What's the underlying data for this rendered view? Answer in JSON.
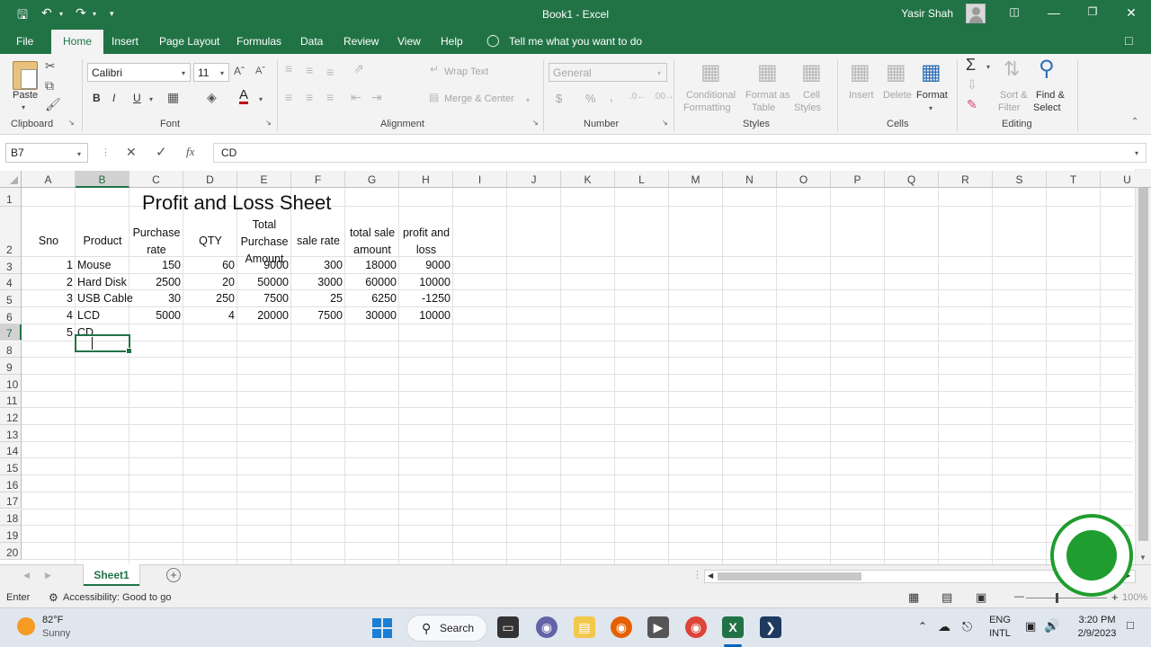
{
  "window": {
    "title": "Book1  -  Excel",
    "user": "Yasir Shah"
  },
  "menu_tabs": [
    "File",
    "Home",
    "Insert",
    "Page Layout",
    "Formulas",
    "Data",
    "Review",
    "View",
    "Help"
  ],
  "tell_me": "Tell me what you want to do",
  "ribbon": {
    "clipboard": {
      "paste": "Paste",
      "label": "Clipboard"
    },
    "font": {
      "family": "Calibri",
      "size": "11",
      "label": "Font",
      "bold": "B",
      "italic": "I",
      "underline": "U"
    },
    "alignment": {
      "wrap_text": "Wrap Text",
      "merge_center": "Merge & Center",
      "label": "Alignment"
    },
    "number": {
      "format": "General",
      "currency": "$",
      "percent": "%",
      "comma": ",",
      "label": "Number"
    },
    "styles": {
      "conditional_1": "Conditional",
      "conditional_2": "Formatting",
      "format_as_1": "Format as",
      "format_as_2": "Table",
      "cell_styles_1": "Cell",
      "cell_styles_2": "Styles",
      "label": "Styles"
    },
    "cells": {
      "insert": "Insert",
      "delete": "Delete",
      "format": "Format",
      "label": "Cells"
    },
    "editing": {
      "sort_1": "Sort &",
      "sort_2": "Filter",
      "find_1": "Find &",
      "find_2": "Select",
      "label": "Editing"
    }
  },
  "formula_bar": {
    "name_box": "B7",
    "cancel": "✕",
    "enter": "✓",
    "fx": "fx",
    "content": "CD"
  },
  "grid": {
    "columns": [
      "A",
      "B",
      "C",
      "D",
      "E",
      "F",
      "G",
      "H",
      "I",
      "J",
      "K",
      "L",
      "M",
      "N",
      "O",
      "P",
      "Q",
      "R",
      "S",
      "T",
      "U"
    ],
    "rows": [
      "1",
      "2",
      "3",
      "4",
      "5",
      "6",
      "7",
      "8",
      "9",
      "10",
      "11",
      "12",
      "13",
      "14",
      "15",
      "16",
      "17",
      "18",
      "19",
      "20"
    ],
    "title": "Profit and Loss Sheet",
    "headers": {
      "sno": "Sno",
      "product": "Product",
      "purchase_rate": "Purchase rate",
      "qty": "QTY",
      "total_purchase": "Total Purchase Amount",
      "sale_rate": "sale rate",
      "total_sale": "total sale amount",
      "profit_loss": "profit and loss"
    },
    "data": [
      [
        "1",
        "Mouse",
        "150",
        "60",
        "9000",
        "300",
        "18000",
        "9000"
      ],
      [
        "2",
        "Hard Disk",
        "2500",
        "20",
        "50000",
        "3000",
        "60000",
        "10000"
      ],
      [
        "3",
        "USB Cable",
        "30",
        "250",
        "7500",
        "25",
        "6250",
        "-1250"
      ],
      [
        "4",
        "LCD",
        "5000",
        "4",
        "20000",
        "7500",
        "30000",
        "10000"
      ],
      [
        "5",
        "CD",
        "",
        "",
        "",
        "",
        "",
        ""
      ]
    ],
    "active_cell": "B7"
  },
  "sheets": {
    "active": "Sheet1",
    "add": "+"
  },
  "status": {
    "mode": "Enter",
    "accessibility": "Accessibility: Good to go",
    "zoom": "100%"
  },
  "taskbar": {
    "weather_temp": "82°F",
    "weather_desc": "Sunny",
    "search": "Search",
    "lang_1": "ENG",
    "lang_2": "INTL",
    "time": "3:20 PM",
    "date": "2/9/2023"
  },
  "colors": {
    "excel_green": "#217346",
    "ribbon_bg": "#f3f3f3",
    "grid_line": "#e1e1e1"
  }
}
